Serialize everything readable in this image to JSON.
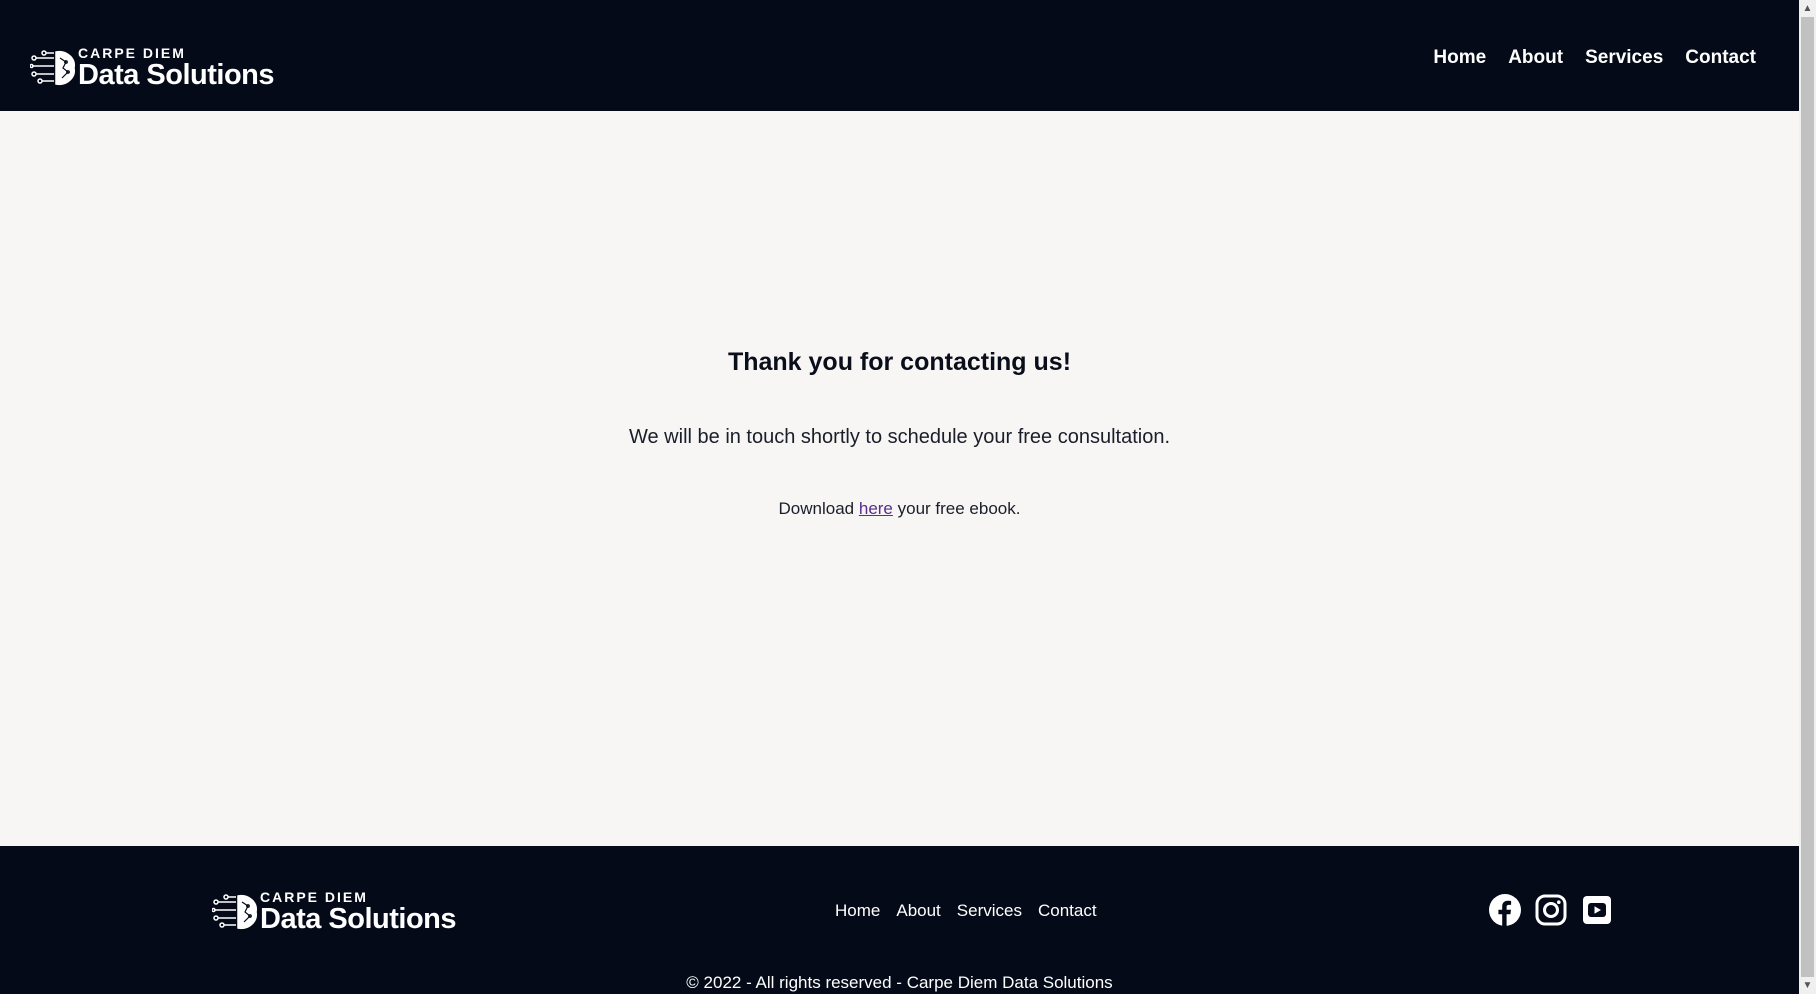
{
  "brand": {
    "small": "CARPE DIEM",
    "big": "Data Solutions"
  },
  "nav": {
    "home": "Home",
    "about": "About",
    "services": "Services",
    "contact": "Contact"
  },
  "main": {
    "title": "Thank you for contacting us!",
    "subtitle": "We will be in touch shortly to schedule your free consultation.",
    "download_prefix": "Download",
    "download_link": "here",
    "download_suffix": "your free ebook."
  },
  "footer": {
    "nav": {
      "home": "Home",
      "about": "About",
      "services": "Services",
      "contact": "Contact"
    },
    "social": [
      "facebook-icon",
      "instagram-icon",
      "youtube-icon"
    ],
    "copyright": "© 2022 - All rights reserved - Carpe Diem Data Solutions"
  },
  "colors": {
    "dark": "#040a18",
    "background": "#f7f6f4",
    "link": "#5a2d8a"
  }
}
